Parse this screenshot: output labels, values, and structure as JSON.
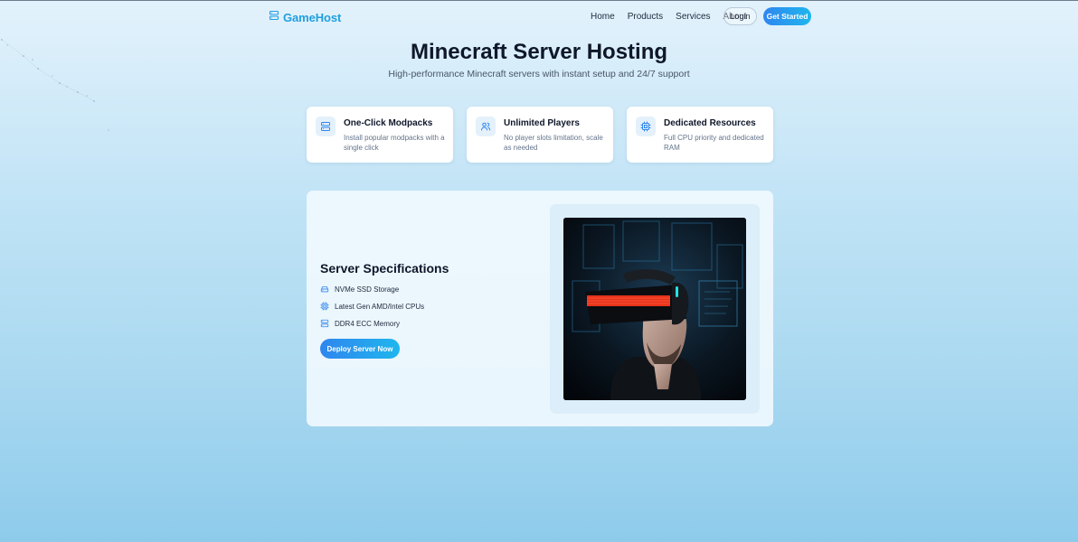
{
  "brand": {
    "name": "GameHost",
    "icon": "server-icon",
    "color": "#1f9fe0"
  },
  "nav": {
    "links": [
      "Home",
      "Products",
      "Services",
      "About"
    ],
    "login_label": "Login",
    "cta_label": "Get Started"
  },
  "hero": {
    "title": "Minecraft Server Hosting",
    "subtitle": "High-performance Minecraft servers with instant setup and 24/7 support"
  },
  "features": [
    {
      "title": "One-Click Modpacks",
      "description": "Install popular modpacks with a single click",
      "icon": "server-icon"
    },
    {
      "title": "Unlimited Players",
      "description": "No player slots limitation, scale as needed",
      "icon": "users-icon"
    },
    {
      "title": "Dedicated Resources",
      "description": "Full CPU priority and dedicated RAM",
      "icon": "cpu-icon"
    }
  ],
  "specs": {
    "title": "Server Specifications",
    "items": [
      {
        "label": "NVMe SSD Storage",
        "icon": "storage-icon"
      },
      {
        "label": "Latest Gen AMD/Intel CPUs",
        "icon": "cpu-icon"
      },
      {
        "label": "DDR4 ECC Memory",
        "icon": "server-icon"
      }
    ],
    "button_label": "Deploy Server Now",
    "image": "vr-headset-photo"
  },
  "colors": {
    "accent_start": "#2f86ee",
    "accent_end": "#1fb6ee",
    "icon": "#2f86ee"
  }
}
